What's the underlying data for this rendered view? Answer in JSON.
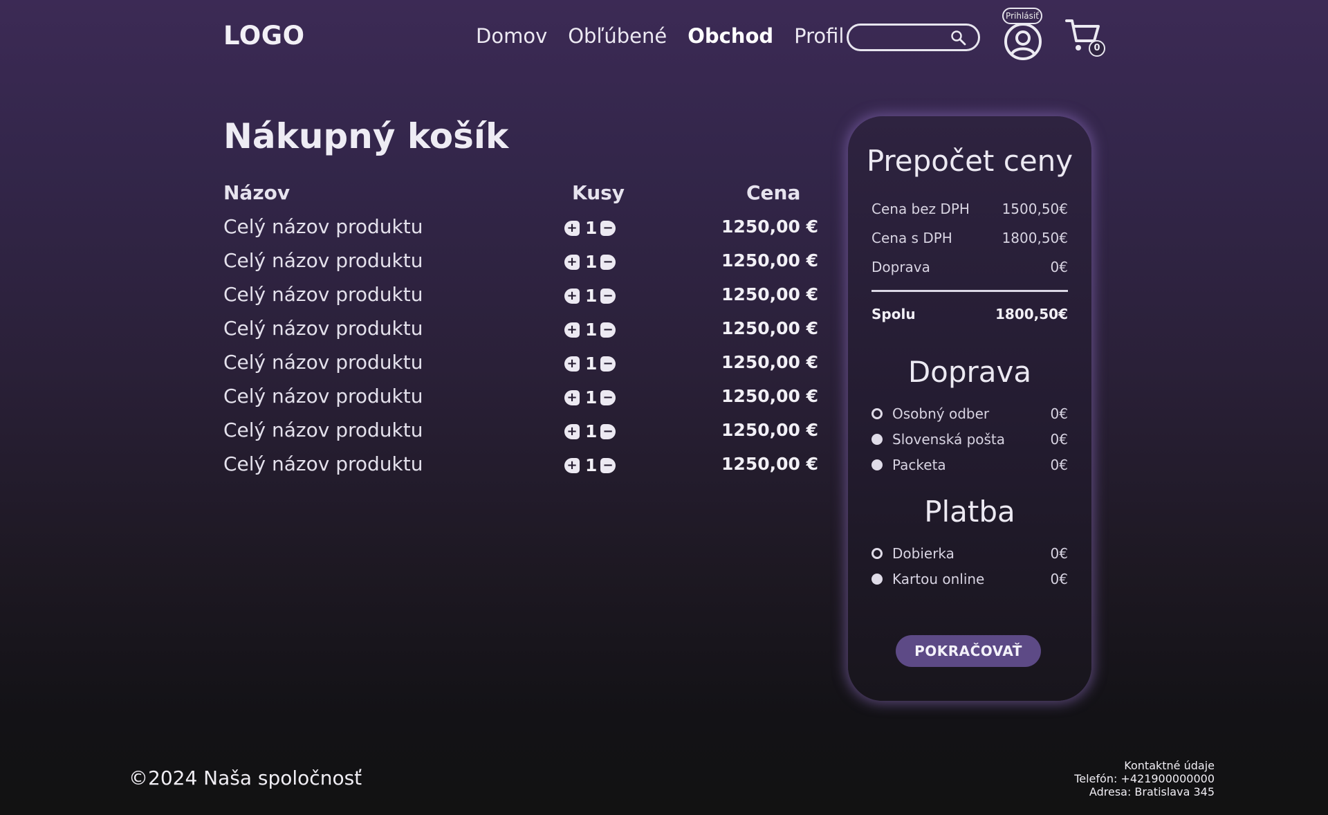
{
  "header": {
    "logo": "LOGO",
    "nav": [
      {
        "label": "Domov",
        "active": false
      },
      {
        "label": "Obľúbené",
        "active": false
      },
      {
        "label": "Obchod",
        "active": true
      },
      {
        "label": "Profil",
        "active": false
      }
    ],
    "search": {
      "placeholder": "",
      "value": ""
    },
    "login_label": "Prihlásiť",
    "cart_count": "0"
  },
  "cart": {
    "title": "Nákupný košík",
    "columns": {
      "name": "Názov",
      "qty": "Kusy",
      "price": "Cena"
    },
    "items": [
      {
        "name": "Celý názov produktu",
        "qty": "1",
        "price": "1250,00 €"
      },
      {
        "name": "Celý názov produktu",
        "qty": "1",
        "price": "1250,00 €"
      },
      {
        "name": "Celý názov produktu",
        "qty": "1",
        "price": "1250,00 €"
      },
      {
        "name": "Celý názov produktu",
        "qty": "1",
        "price": "1250,00 €"
      },
      {
        "name": "Celý názov produktu",
        "qty": "1",
        "price": "1250,00 €"
      },
      {
        "name": "Celý názov produktu",
        "qty": "1",
        "price": "1250,00 €"
      },
      {
        "name": "Celý názov produktu",
        "qty": "1",
        "price": "1250,00 €"
      },
      {
        "name": "Celý názov produktu",
        "qty": "1",
        "price": "1250,00 €"
      }
    ]
  },
  "summary": {
    "title": "Prepočet ceny",
    "rows": [
      {
        "label": "Cena bez DPH",
        "value": "1500,50€"
      },
      {
        "label": "Cena s DPH",
        "value": "1800,50€"
      },
      {
        "label": "Doprava",
        "value": "0€"
      }
    ],
    "total": {
      "label": "Spolu",
      "value": "1800,50€"
    },
    "shipping": {
      "title": "Doprava",
      "options": [
        {
          "label": "Osobný odber",
          "value": "0€",
          "selected": true
        },
        {
          "label": "Slovenská pošta",
          "value": "0€",
          "selected": false
        },
        {
          "label": "Packeta",
          "value": "0€",
          "selected": false
        }
      ]
    },
    "payment": {
      "title": "Platba",
      "options": [
        {
          "label": "Dobierka",
          "value": "0€",
          "selected": true
        },
        {
          "label": "Kartou online",
          "value": "0€",
          "selected": false
        }
      ]
    },
    "continue_label": "POKRAČOVAŤ"
  },
  "footer": {
    "copyright": "©2024  Naša spoločnosť",
    "contact_title": "Kontaktné údaje",
    "phone": "Telefón: +421900000000",
    "address": "Adresa: Bratislava 345"
  },
  "colors": {
    "accent": "#5d4a86",
    "background_top": "#3c2a55",
    "background_bottom": "#121212"
  },
  "icons": {
    "search": "search-icon",
    "user": "user-icon",
    "cart": "cart-icon",
    "plus": "plus-icon",
    "minus": "minus-icon"
  }
}
